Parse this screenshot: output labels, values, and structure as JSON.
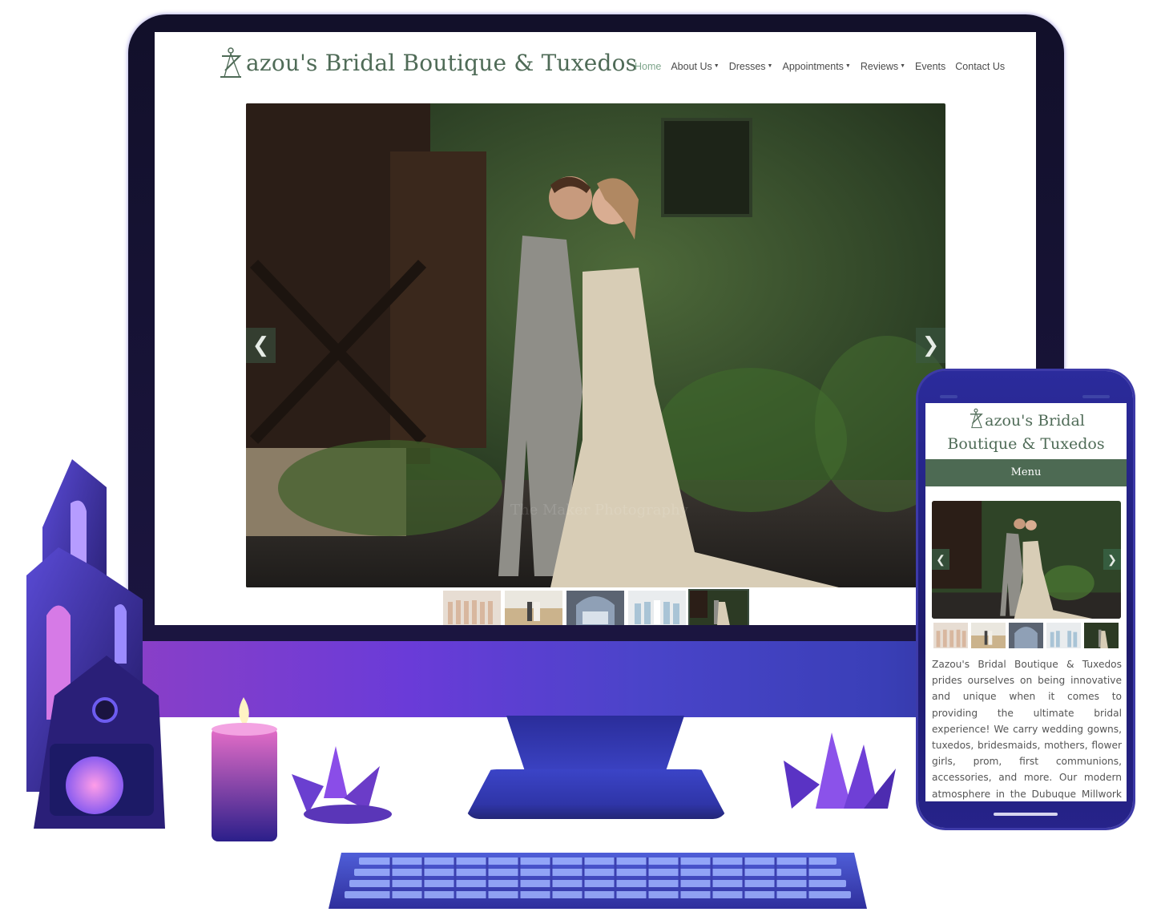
{
  "site": {
    "name": "Zazou's Bridal Boutique & Tuxedos",
    "logo_text_desktop": "azou's Bridal Boutique & Tuxedos",
    "logo_text_mobile_line1": "azou's Bridal",
    "logo_text_mobile_line2": "Boutique & Tuxedos"
  },
  "nav": {
    "items": [
      {
        "label": "Home",
        "dropdown": false,
        "active": true
      },
      {
        "label": "About Us",
        "dropdown": true
      },
      {
        "label": "Dresses",
        "dropdown": true
      },
      {
        "label": "Appointments",
        "dropdown": true
      },
      {
        "label": "Reviews",
        "dropdown": true
      },
      {
        "label": "Events",
        "dropdown": false
      },
      {
        "label": "Contact Us",
        "dropdown": false
      }
    ]
  },
  "carousel": {
    "prev_icon": "chevron-left-icon",
    "next_icon": "chevron-right-icon",
    "prev_glyph": "❮",
    "next_glyph": "❯",
    "thumbnail_count": 5,
    "active_thumbnail": 5
  },
  "mobile": {
    "menu_label": "Menu",
    "intro_text": "Zazou's Bridal Boutique & Tuxedos prides ourselves on being innovative and unique when it comes to providing the ultimate bridal experience! We carry wedding gowns, tuxedos, bridesmaids, mothers, flower girls, prom, first communions, accessories, and more. Our modern atmosphere in the Dubuque Millwork District is the perfect"
  },
  "colors": {
    "brand_green": "#4f6b57",
    "menu_bar": "#4d6a53",
    "nav_active": "#7fa68c",
    "device_purple": "#2b2b9c"
  }
}
